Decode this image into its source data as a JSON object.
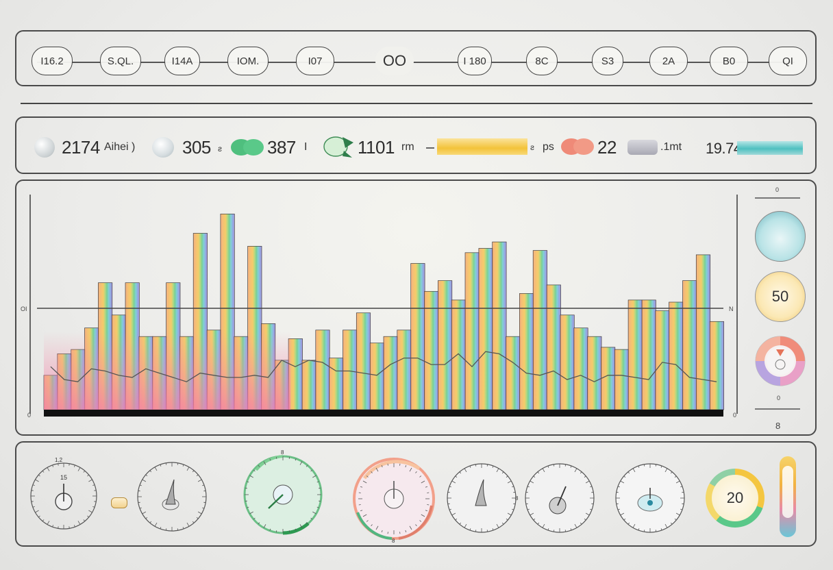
{
  "step_bar": {
    "steps": [
      {
        "label": "I16.2"
      },
      {
        "label": "S.QL."
      },
      {
        "label": "I14A"
      },
      {
        "label": "IOM."
      },
      {
        "label": "I07"
      },
      {
        "label": "OO"
      },
      {
        "label": "I 180"
      },
      {
        "label": "8C"
      },
      {
        "label": "S3"
      },
      {
        "label": "2A"
      },
      {
        "label": "B0"
      },
      {
        "label": "QI"
      }
    ]
  },
  "stats": {
    "s1_value": "2174",
    "s1_label": "Aihei )",
    "s2_value": "305",
    "s2_suffix": "ƨ",
    "s3_value": "387",
    "s3_suffix": "I",
    "s4_value": "1101",
    "s4_unit": "rm",
    "s5_label": "ps",
    "s5_value": "22",
    "s6_label": ".1mt",
    "s7_value": "19.74"
  },
  "chart": {
    "y_label_left": "OI",
    "y_label_right": "N",
    "baseline_left": "0",
    "baseline_right": "0"
  },
  "side_indicators": {
    "top_tick": "0",
    "knob_value": "50",
    "bottom_tick": "0",
    "foot_label": "8"
  },
  "gauges": {
    "g1_label": "15",
    "g1_top": "1,2",
    "g3_top": "8",
    "g5_mid": "8",
    "g7_value": "20",
    "g4_bottom": "8"
  },
  "chart_data": {
    "type": "bar",
    "series": [
      {
        "values": [
          20,
          14,
          13,
          19,
          18,
          16,
          15,
          19,
          17,
          15,
          13,
          17,
          16,
          15,
          15,
          16,
          15,
          23,
          20,
          23,
          22,
          18,
          18,
          17,
          16,
          21,
          24,
          24,
          21,
          21,
          26,
          20,
          27,
          26,
          22,
          17,
          16,
          18,
          14,
          16,
          13,
          16,
          16,
          15,
          14,
          22,
          21,
          15,
          14,
          13
        ]
      },
      {
        "values": [
          16,
          26,
          28,
          38,
          59,
          44,
          59,
          34,
          34,
          59,
          34,
          82,
          37,
          91,
          34,
          76,
          40,
          23,
          33,
          23,
          37,
          24,
          37,
          45,
          31,
          34,
          37,
          68,
          55,
          60,
          51,
          73,
          75,
          78,
          34,
          54,
          74,
          58,
          44,
          38,
          34,
          29,
          28,
          51,
          51,
          46,
          50,
          60,
          72,
          41
        ]
      }
    ],
    "ylim": [
      0,
      100
    ],
    "grid": false,
    "legend": "none"
  },
  "colors": {
    "accent_green": "#5bc48a",
    "accent_coral": "#ef7f6a",
    "accent_yellow": "#f5c443",
    "accent_teal": "#58c9c9",
    "accent_purple": "#8e7fdc",
    "frame": "#4a4a4a"
  }
}
